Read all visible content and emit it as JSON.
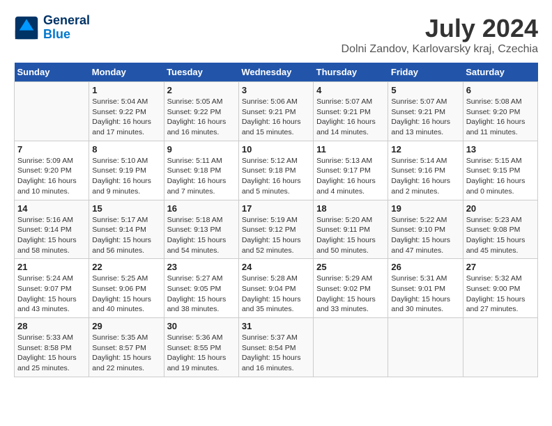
{
  "header": {
    "logo_line1": "General",
    "logo_line2": "Blue",
    "title": "July 2024",
    "subtitle": "Dolni Zandov, Karlovarsky kraj, Czechia"
  },
  "calendar": {
    "weekdays": [
      "Sunday",
      "Monday",
      "Tuesday",
      "Wednesday",
      "Thursday",
      "Friday",
      "Saturday"
    ],
    "weeks": [
      [
        {
          "day": "",
          "info": ""
        },
        {
          "day": "1",
          "info": "Sunrise: 5:04 AM\nSunset: 9:22 PM\nDaylight: 16 hours and 17 minutes."
        },
        {
          "day": "2",
          "info": "Sunrise: 5:05 AM\nSunset: 9:22 PM\nDaylight: 16 hours and 16 minutes."
        },
        {
          "day": "3",
          "info": "Sunrise: 5:06 AM\nSunset: 9:21 PM\nDaylight: 16 hours and 15 minutes."
        },
        {
          "day": "4",
          "info": "Sunrise: 5:07 AM\nSunset: 9:21 PM\nDaylight: 16 hours and 14 minutes."
        },
        {
          "day": "5",
          "info": "Sunrise: 5:07 AM\nSunset: 9:21 PM\nDaylight: 16 hours and 13 minutes."
        },
        {
          "day": "6",
          "info": "Sunrise: 5:08 AM\nSunset: 9:20 PM\nDaylight: 16 hours and 11 minutes."
        }
      ],
      [
        {
          "day": "7",
          "info": "Sunrise: 5:09 AM\nSunset: 9:20 PM\nDaylight: 16 hours and 10 minutes."
        },
        {
          "day": "8",
          "info": "Sunrise: 5:10 AM\nSunset: 9:19 PM\nDaylight: 16 hours and 9 minutes."
        },
        {
          "day": "9",
          "info": "Sunrise: 5:11 AM\nSunset: 9:18 PM\nDaylight: 16 hours and 7 minutes."
        },
        {
          "day": "10",
          "info": "Sunrise: 5:12 AM\nSunset: 9:18 PM\nDaylight: 16 hours and 5 minutes."
        },
        {
          "day": "11",
          "info": "Sunrise: 5:13 AM\nSunset: 9:17 PM\nDaylight: 16 hours and 4 minutes."
        },
        {
          "day": "12",
          "info": "Sunrise: 5:14 AM\nSunset: 9:16 PM\nDaylight: 16 hours and 2 minutes."
        },
        {
          "day": "13",
          "info": "Sunrise: 5:15 AM\nSunset: 9:15 PM\nDaylight: 16 hours and 0 minutes."
        }
      ],
      [
        {
          "day": "14",
          "info": "Sunrise: 5:16 AM\nSunset: 9:14 PM\nDaylight: 15 hours and 58 minutes."
        },
        {
          "day": "15",
          "info": "Sunrise: 5:17 AM\nSunset: 9:14 PM\nDaylight: 15 hours and 56 minutes."
        },
        {
          "day": "16",
          "info": "Sunrise: 5:18 AM\nSunset: 9:13 PM\nDaylight: 15 hours and 54 minutes."
        },
        {
          "day": "17",
          "info": "Sunrise: 5:19 AM\nSunset: 9:12 PM\nDaylight: 15 hours and 52 minutes."
        },
        {
          "day": "18",
          "info": "Sunrise: 5:20 AM\nSunset: 9:11 PM\nDaylight: 15 hours and 50 minutes."
        },
        {
          "day": "19",
          "info": "Sunrise: 5:22 AM\nSunset: 9:10 PM\nDaylight: 15 hours and 47 minutes."
        },
        {
          "day": "20",
          "info": "Sunrise: 5:23 AM\nSunset: 9:08 PM\nDaylight: 15 hours and 45 minutes."
        }
      ],
      [
        {
          "day": "21",
          "info": "Sunrise: 5:24 AM\nSunset: 9:07 PM\nDaylight: 15 hours and 43 minutes."
        },
        {
          "day": "22",
          "info": "Sunrise: 5:25 AM\nSunset: 9:06 PM\nDaylight: 15 hours and 40 minutes."
        },
        {
          "day": "23",
          "info": "Sunrise: 5:27 AM\nSunset: 9:05 PM\nDaylight: 15 hours and 38 minutes."
        },
        {
          "day": "24",
          "info": "Sunrise: 5:28 AM\nSunset: 9:04 PM\nDaylight: 15 hours and 35 minutes."
        },
        {
          "day": "25",
          "info": "Sunrise: 5:29 AM\nSunset: 9:02 PM\nDaylight: 15 hours and 33 minutes."
        },
        {
          "day": "26",
          "info": "Sunrise: 5:31 AM\nSunset: 9:01 PM\nDaylight: 15 hours and 30 minutes."
        },
        {
          "day": "27",
          "info": "Sunrise: 5:32 AM\nSunset: 9:00 PM\nDaylight: 15 hours and 27 minutes."
        }
      ],
      [
        {
          "day": "28",
          "info": "Sunrise: 5:33 AM\nSunset: 8:58 PM\nDaylight: 15 hours and 25 minutes."
        },
        {
          "day": "29",
          "info": "Sunrise: 5:35 AM\nSunset: 8:57 PM\nDaylight: 15 hours and 22 minutes."
        },
        {
          "day": "30",
          "info": "Sunrise: 5:36 AM\nSunset: 8:55 PM\nDaylight: 15 hours and 19 minutes."
        },
        {
          "day": "31",
          "info": "Sunrise: 5:37 AM\nSunset: 8:54 PM\nDaylight: 15 hours and 16 minutes."
        },
        {
          "day": "",
          "info": ""
        },
        {
          "day": "",
          "info": ""
        },
        {
          "day": "",
          "info": ""
        }
      ]
    ]
  }
}
